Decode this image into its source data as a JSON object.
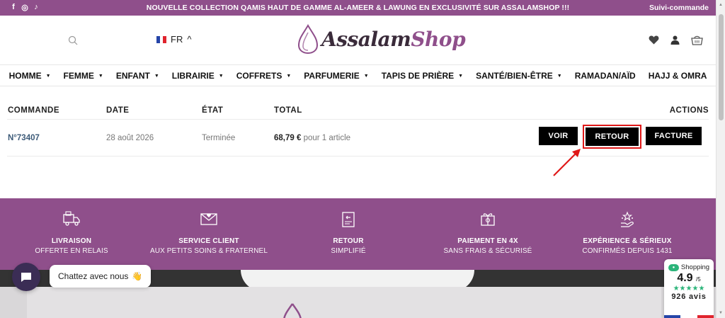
{
  "topbar": {
    "social": [
      "f",
      "◎",
      "♪"
    ],
    "announcement": "NOUVELLE COLLECTION QAMIS HAUT DE GAMME AL-AMEER & LAWUNG EN EXCLUSIVITÉ SUR ASSALAMSHOP !!!",
    "suivi": "Suivi-commande"
  },
  "header": {
    "lang": "FR",
    "lang_caret": "^",
    "logo_part1": "Assalam",
    "logo_part2": "Shop"
  },
  "nav": [
    {
      "label": "HOMME",
      "caret": "▼"
    },
    {
      "label": "FEMME",
      "caret": "▼"
    },
    {
      "label": "ENFANT",
      "caret": "▼"
    },
    {
      "label": "LIBRAIRIE",
      "caret": "▼"
    },
    {
      "label": "COFFRETS",
      "caret": "▼"
    },
    {
      "label": "PARFUMERIE",
      "caret": "▼"
    },
    {
      "label": "TAPIS DE PRIÈRE",
      "caret": "▼"
    },
    {
      "label": "SANTÉ/BIEN-ÊTRE",
      "caret": "▼"
    },
    {
      "label": "RAMADAN/AÏD",
      "caret": ""
    },
    {
      "label": "HAJJ & OMRA",
      "caret": ""
    }
  ],
  "orders": {
    "headers": {
      "commande": "COMMANDE",
      "date": "DATE",
      "etat": "ÉTAT",
      "total": "TOTAL",
      "actions": "ACTIONS"
    },
    "row": {
      "number": "N°73407",
      "date": "28 août 2026",
      "status": "Terminée",
      "total_amount": "68,79 €",
      "total_suffix": " pour 1 article"
    },
    "buttons": {
      "view": "VOIR",
      "return": "RETOUR",
      "invoice": "FACTURE"
    }
  },
  "features": [
    {
      "title": "LIVRAISON",
      "subtitle": "OFFERTE EN RELAIS",
      "icon": "truck-icon"
    },
    {
      "title": "SERVICE CLIENT",
      "subtitle": "AUX PETITS SOINS & FRATERNEL",
      "icon": "envelope-heart-icon"
    },
    {
      "title": "RETOUR",
      "subtitle": "SIMPLIFIÉ",
      "icon": "return-box-icon"
    },
    {
      "title": "PAIEMENT EN 4X",
      "subtitle": "SANS FRAIS & SÉCURISÉ",
      "icon": "gift-card-icon"
    },
    {
      "title": "EXPÉRIENCE & SÉRIEUX",
      "subtitle": "CONFIRMÉS DEPUIS 1431",
      "icon": "stars-hand-icon"
    }
  ],
  "chat": {
    "label": "Chattez avec nous",
    "emoji": "👋"
  },
  "reviews": {
    "badge": "Shopping",
    "score": "4.9",
    "score_suffix": "/5",
    "stars": "★★★★★",
    "count": "926 avis"
  },
  "colors": {
    "brand": "#8f4f8b",
    "highlight": "#e01818",
    "rating": "#2cb57a"
  }
}
